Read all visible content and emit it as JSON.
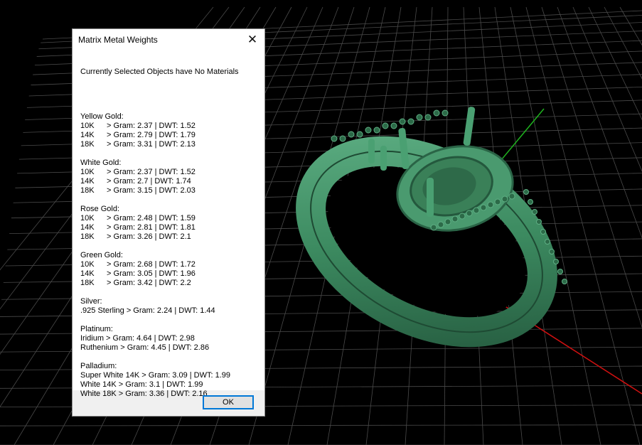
{
  "dialog": {
    "title": "Matrix Metal Weights",
    "header": "Currently Selected Objects have No Materials",
    "ok_label": "OK",
    "close_icon": "close-icon",
    "groups": [
      {
        "name": "Yellow Gold:",
        "rows": [
          {
            "k": "10K",
            "v": " > Gram: 2.37 | DWT: 1.52"
          },
          {
            "k": "14K",
            "v": " > Gram: 2.79 | DWT: 1.79"
          },
          {
            "k": "18K",
            "v": " > Gram: 3.31 | DWT: 2.13"
          }
        ]
      },
      {
        "name": "White Gold:",
        "rows": [
          {
            "k": "10K",
            "v": " > Gram: 2.37 | DWT: 1.52"
          },
          {
            "k": "14K",
            "v": " > Gram: 2.7 | DWT: 1.74"
          },
          {
            "k": "18K",
            "v": " > Gram: 3.15 | DWT: 2.03"
          }
        ]
      },
      {
        "name": "Rose Gold:",
        "rows": [
          {
            "k": "10K",
            "v": " > Gram: 2.48 | DWT: 1.59"
          },
          {
            "k": "14K",
            "v": " > Gram: 2.81 | DWT: 1.81"
          },
          {
            "k": "18K",
            "v": " > Gram: 3.26 | DWT: 2.1"
          }
        ]
      },
      {
        "name": "Green Gold:",
        "rows": [
          {
            "k": "10K",
            "v": " > Gram: 2.68 | DWT: 1.72"
          },
          {
            "k": "14K",
            "v": " > Gram: 3.05 | DWT: 1.96"
          },
          {
            "k": "18K",
            "v": " > Gram: 3.42 | DWT: 2.2"
          }
        ]
      },
      {
        "name": "Silver:",
        "rows": [
          {
            "k": "",
            "v": ".925 Sterling > Gram: 2.24 | DWT: 1.44"
          }
        ]
      },
      {
        "name": "Platinum:",
        "rows": [
          {
            "k": "",
            "v": "Iridium > Gram: 4.64 | DWT: 2.98"
          },
          {
            "k": "",
            "v": "Ruthenium > Gram: 4.45 | DWT: 2.86"
          }
        ]
      },
      {
        "name": "Palladium:",
        "rows": [
          {
            "k": "",
            "v": "Super White 14K > Gram: 3.09 | DWT: 1.99"
          },
          {
            "k": "",
            "v": "White 14K > Gram: 3.1 | DWT: 1.99"
          },
          {
            "k": "",
            "v": "White 18K > Gram: 3.36 | DWT: 2.16"
          }
        ]
      }
    ]
  },
  "viewport": {
    "background": "#000000",
    "grid_color": "#4a4a4a",
    "axis_x_color": "#d01010",
    "axis_y_color": "#20b020",
    "model_color": "#3f8f64"
  }
}
